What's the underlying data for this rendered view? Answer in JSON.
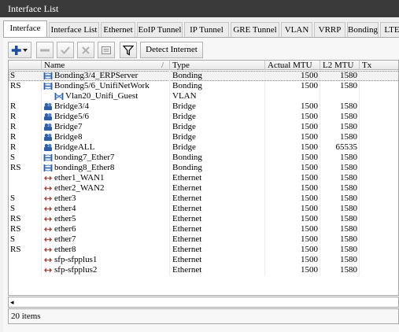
{
  "window": {
    "title": "Interface List"
  },
  "tabs": [
    {
      "label": "Interface",
      "active": true
    },
    {
      "label": "Interface List"
    },
    {
      "label": "Ethernet"
    },
    {
      "label": "EoIP Tunnel"
    },
    {
      "label": "IP Tunnel"
    },
    {
      "label": "GRE Tunnel"
    },
    {
      "label": "VLAN"
    },
    {
      "label": "VRRP"
    },
    {
      "label": "Bonding"
    },
    {
      "label": "LTE"
    }
  ],
  "toolbar": {
    "add_icon": "plus-icon",
    "remove_icon": "minus-icon",
    "enable_icon": "check-icon",
    "disable_icon": "cross-icon",
    "comment_icon": "comment-icon",
    "filter_icon": "filter-icon",
    "detect_label": "Detect Internet"
  },
  "table": {
    "columns": [
      "",
      "Name",
      "Type",
      "Actual MTU",
      "L2 MTU",
      "Tx"
    ],
    "sort_indicator": "/",
    "rows": [
      {
        "flags": "S",
        "name": "Bonding3/4_ERPServer",
        "type": "Bonding",
        "mtu": "1500",
        "l2mtu": "1580",
        "icon": "bonding-icon",
        "selected": true
      },
      {
        "flags": "RS",
        "name": "Bonding5/6_UnifiNetWork",
        "type": "Bonding",
        "mtu": "1500",
        "l2mtu": "1580",
        "icon": "bonding-icon"
      },
      {
        "flags": "",
        "name": "Vlan20_Unifi_Guest",
        "type": "VLAN",
        "mtu": "",
        "l2mtu": "",
        "icon": "vlan-icon",
        "indent": 1
      },
      {
        "flags": "R",
        "name": "Bridge3/4",
        "type": "Bridge",
        "mtu": "1500",
        "l2mtu": "1580",
        "icon": "bridge-icon"
      },
      {
        "flags": "R",
        "name": "Bridge5/6",
        "type": "Bridge",
        "mtu": "1500",
        "l2mtu": "1580",
        "icon": "bridge-icon"
      },
      {
        "flags": "R",
        "name": "Bridge7",
        "type": "Bridge",
        "mtu": "1500",
        "l2mtu": "1580",
        "icon": "bridge-icon"
      },
      {
        "flags": "R",
        "name": "Bridge8",
        "type": "Bridge",
        "mtu": "1500",
        "l2mtu": "1580",
        "icon": "bridge-icon"
      },
      {
        "flags": "R",
        "name": "BridgeALL",
        "type": "Bridge",
        "mtu": "1500",
        "l2mtu": "65535",
        "icon": "bridge-icon"
      },
      {
        "flags": "S",
        "name": "bonding7_Ether7",
        "type": "Bonding",
        "mtu": "1500",
        "l2mtu": "1580",
        "icon": "bonding-icon"
      },
      {
        "flags": "RS",
        "name": "bonding8_Ether8",
        "type": "Bonding",
        "mtu": "1500",
        "l2mtu": "1580",
        "icon": "bonding-icon"
      },
      {
        "flags": "",
        "name": "ether1_WAN1",
        "type": "Ethernet",
        "mtu": "1500",
        "l2mtu": "1580",
        "icon": "ethernet-icon"
      },
      {
        "flags": "",
        "name": "ether2_WAN2",
        "type": "Ethernet",
        "mtu": "1500",
        "l2mtu": "1580",
        "icon": "ethernet-icon"
      },
      {
        "flags": "S",
        "name": "ether3",
        "type": "Ethernet",
        "mtu": "1500",
        "l2mtu": "1580",
        "icon": "ethernet-icon"
      },
      {
        "flags": "S",
        "name": "ether4",
        "type": "Ethernet",
        "mtu": "1500",
        "l2mtu": "1580",
        "icon": "ethernet-icon"
      },
      {
        "flags": "RS",
        "name": "ether5",
        "type": "Ethernet",
        "mtu": "1500",
        "l2mtu": "1580",
        "icon": "ethernet-icon"
      },
      {
        "flags": "RS",
        "name": "ether6",
        "type": "Ethernet",
        "mtu": "1500",
        "l2mtu": "1580",
        "icon": "ethernet-icon"
      },
      {
        "flags": "S",
        "name": "ether7",
        "type": "Ethernet",
        "mtu": "1500",
        "l2mtu": "1580",
        "icon": "ethernet-icon"
      },
      {
        "flags": "RS",
        "name": "ether8",
        "type": "Ethernet",
        "mtu": "1500",
        "l2mtu": "1580",
        "icon": "ethernet-icon"
      },
      {
        "flags": "",
        "name": "sfp-sfpplus1",
        "type": "Ethernet",
        "mtu": "1500",
        "l2mtu": "1580",
        "icon": "ethernet-icon"
      },
      {
        "flags": "",
        "name": "sfp-sfpplus2",
        "type": "Ethernet",
        "mtu": "1500",
        "l2mtu": "1580",
        "icon": "ethernet-icon"
      }
    ]
  },
  "scrollbar": {
    "left_arrow": "◂"
  },
  "status": {
    "count_text": "20 items"
  },
  "colors": {
    "titlebar": "#3a3a3a",
    "icon_blue": "#2f5ea8",
    "ethernet_red": "#c0392b"
  }
}
